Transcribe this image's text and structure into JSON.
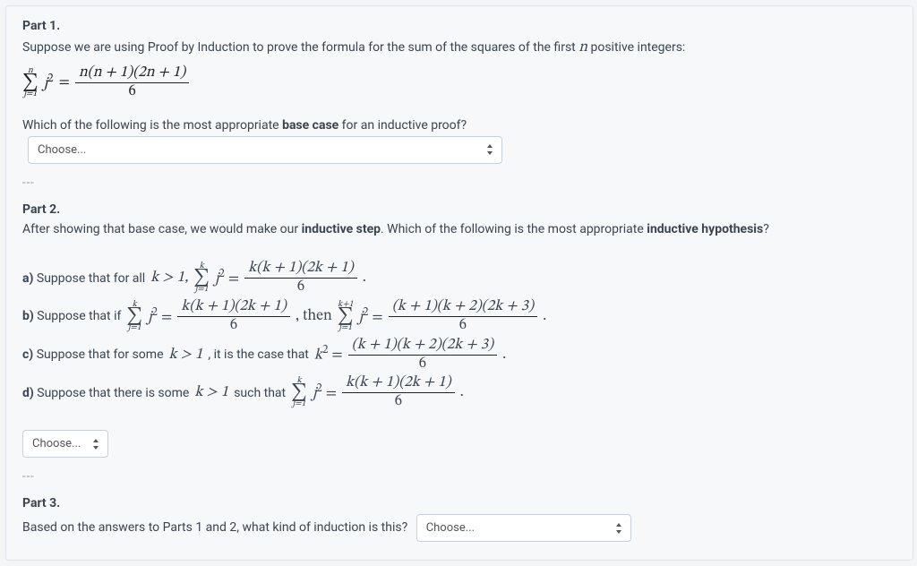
{
  "part1": {
    "header": "Part 1.",
    "intro_prefix": "Suppose we are using Proof by Induction to prove the formula for the sum of the squares of the first ",
    "intro_var": "n",
    "intro_suffix": " positive integers:",
    "formula": {
      "sum_top": "n",
      "sum_bot": "j=1",
      "sum_term": "j",
      "sum_exp": "2",
      "eq": " = ",
      "num": "n(n + 1)(2n + 1)",
      "den": "6"
    },
    "question_prefix": "Which of the following is the most appropriate ",
    "question_bold": "base case",
    "question_suffix": " for an inductive proof?",
    "select_placeholder": "Choose..."
  },
  "divider": "---",
  "part2": {
    "header": "Part 2.",
    "intro_a": "After showing that base case, we would make our ",
    "intro_bold1": "inductive step",
    "intro_b": ".  Which of the following is the most appropriate ",
    "intro_bold2": "inductive hypothesis",
    "intro_c": "?",
    "options": {
      "a": {
        "label": "a)",
        "text": "  Suppose that for all ",
        "cond": "k > 1, ",
        "sum_top": "k",
        "sum_bot": "j=1",
        "num": "k(k + 1)(2k + 1)",
        "den": "6"
      },
      "b": {
        "label": "b)",
        "text": "  Suppose that if ",
        "sum_top1": "k",
        "sum_bot1": "j=1",
        "num1": "k(k + 1)(2k + 1)",
        "den1": "6",
        "then": " , then ",
        "sum_top2": "k+1",
        "sum_bot2": "j=1",
        "num2": "(k + 1)(k + 2)(2k + 3)",
        "den2": "6"
      },
      "c": {
        "label": "c)",
        "text": "  Suppose that for some ",
        "cond": "k > 1",
        "text2": ", it is the case that ",
        "lhs": "k",
        "lhs_exp": "2",
        "num": "(k + 1)(k + 2)(2k + 3)",
        "den": "6"
      },
      "d": {
        "label": "d)",
        "text": "  Suppose that there is some ",
        "cond": "k > 1",
        "text2": " such that ",
        "sum_top": "k",
        "sum_bot": "j=1",
        "num": "k(k + 1)(2k + 1)",
        "den": "6"
      }
    },
    "select_placeholder": "Choose..."
  },
  "part3": {
    "header": "Part 3.",
    "question": "Based on the answers to Parts 1 and 2, what kind of induction is this?",
    "select_placeholder": "Choose..."
  }
}
